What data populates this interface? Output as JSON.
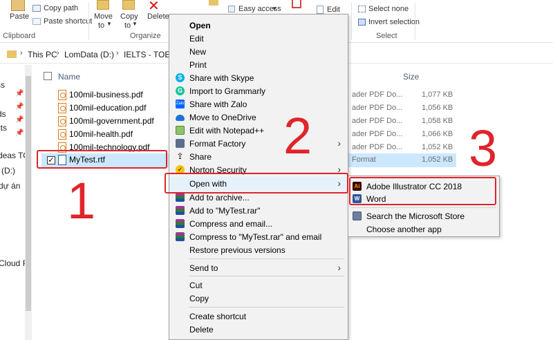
{
  "ribbon": {
    "paste": "Paste",
    "copy_path": "Copy path",
    "paste_shortcut": "Paste shortcut",
    "clipboard": "Clipboard",
    "move_to": "Move",
    "move_to2": "to",
    "copy_to": "Copy",
    "copy_to2": "to",
    "delete": "Delete",
    "organize": "Organize",
    "easy_access": "Easy access",
    "edit": "Edit",
    "select_none": "Select none",
    "invert_selection": "Invert selection",
    "select": "Select"
  },
  "address": {
    "crumbs": [
      "This PC",
      "LomData (D:)",
      "IELTS - TOEFL"
    ]
  },
  "nav": {
    "items": [
      "ss",
      "ds",
      "nts",
      "deas TO",
      "(D:)",
      "dự án",
      "Cloud Fi"
    ]
  },
  "columns": {
    "name": "Name",
    "size": "Size"
  },
  "files": [
    {
      "name": "100mil-business.pdf",
      "type": "ader PDF Do...",
      "size": "1,077 KB"
    },
    {
      "name": "100mil-education.pdf",
      "type": "ader PDF Do...",
      "size": "1,056 KB"
    },
    {
      "name": "100mil-government.pdf",
      "type": "ader PDF Do...",
      "size": "1,058 KB"
    },
    {
      "name": "100mil-health.pdf",
      "type": "ader PDF Do...",
      "size": "1,066 KB"
    },
    {
      "name": "100mil-technology.pdf",
      "type": "ader PDF Do...",
      "size": "1,052 KB"
    },
    {
      "name": "MyTest.rtf",
      "type": "Format",
      "size": "1,052 KB"
    }
  ],
  "context_menu": {
    "open": "Open",
    "edit": "Edit",
    "new": "New",
    "print": "Print",
    "share_skype": "Share with Skype",
    "import_grammarly": "Import to Grammarly",
    "share_zalo": "Share with Zalo",
    "move_onedrive": "Move to OneDrive",
    "edit_notepad": "Edit with Notepad++",
    "format_factory": "Format Factory",
    "share": "Share",
    "norton": "Norton Security",
    "open_with": "Open with",
    "add_archive": "Add to archive...",
    "add_rar": "Add to \"MyTest.rar\"",
    "compress_email": "Compress and email...",
    "compress_rar_email": "Compress to \"MyTest.rar\" and email",
    "restore": "Restore previous versions",
    "send_to": "Send to",
    "cut": "Cut",
    "copy": "Copy",
    "create_shortcut": "Create shortcut",
    "delete": "Delete"
  },
  "submenu": {
    "illustrator": "Adobe Illustrator CC 2018",
    "word": "Word",
    "store": "Search the Microsoft Store",
    "choose": "Choose another app"
  },
  "annotations": {
    "n1": "1",
    "n2": "2",
    "n3": "3"
  },
  "colors": {
    "annotation_red": "#e0242b",
    "selection": "#cce8ff"
  }
}
